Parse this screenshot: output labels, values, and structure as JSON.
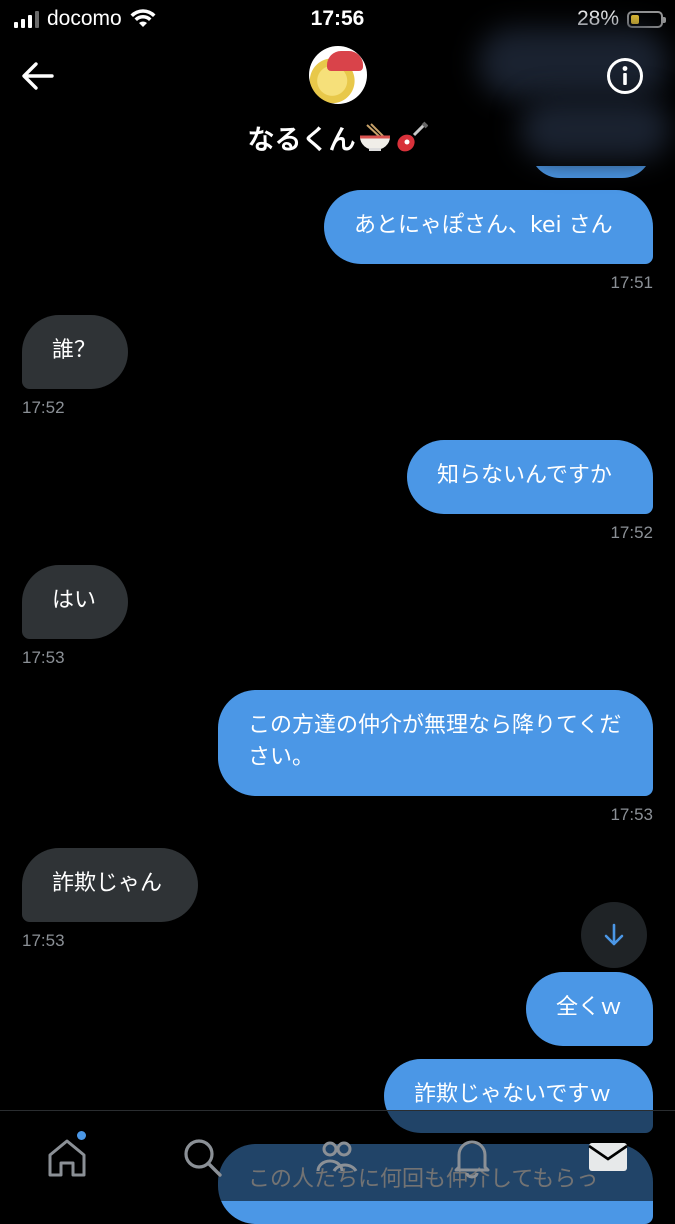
{
  "status_bar": {
    "carrier": "docomo",
    "time": "17:56",
    "battery": "28%",
    "battery_level": 0.28
  },
  "header": {
    "contact_name": "なるくん"
  },
  "messages": [
    {
      "direction": "out",
      "text": "あとにゃぽさん、kei さん",
      "time": "17:51"
    },
    {
      "direction": "in",
      "text": "誰？",
      "time": "17:52"
    },
    {
      "direction": "out",
      "text": "知らないんですか",
      "time": "17:52"
    },
    {
      "direction": "in",
      "text": "はい",
      "time": "17:53"
    },
    {
      "direction": "out",
      "text": "この方達の仲介が無理なら降りてください。",
      "time": "17:53"
    },
    {
      "direction": "in",
      "text": "詐欺じゃん",
      "time": "17:53"
    },
    {
      "direction": "out",
      "text": "全くｗ",
      "time": ""
    },
    {
      "direction": "out",
      "text": "詐欺じゃないですｗ",
      "time": ""
    },
    {
      "direction": "out",
      "text": "この人たちに何回も仲介してもらっ",
      "time": ""
    }
  ],
  "tabs": [
    "home-icon",
    "search-icon",
    "communities-icon",
    "notifications-icon",
    "messages-icon"
  ],
  "colors": {
    "accent": "#4b97e6",
    "incoming_bubble": "#2f3336",
    "background": "#000000"
  }
}
